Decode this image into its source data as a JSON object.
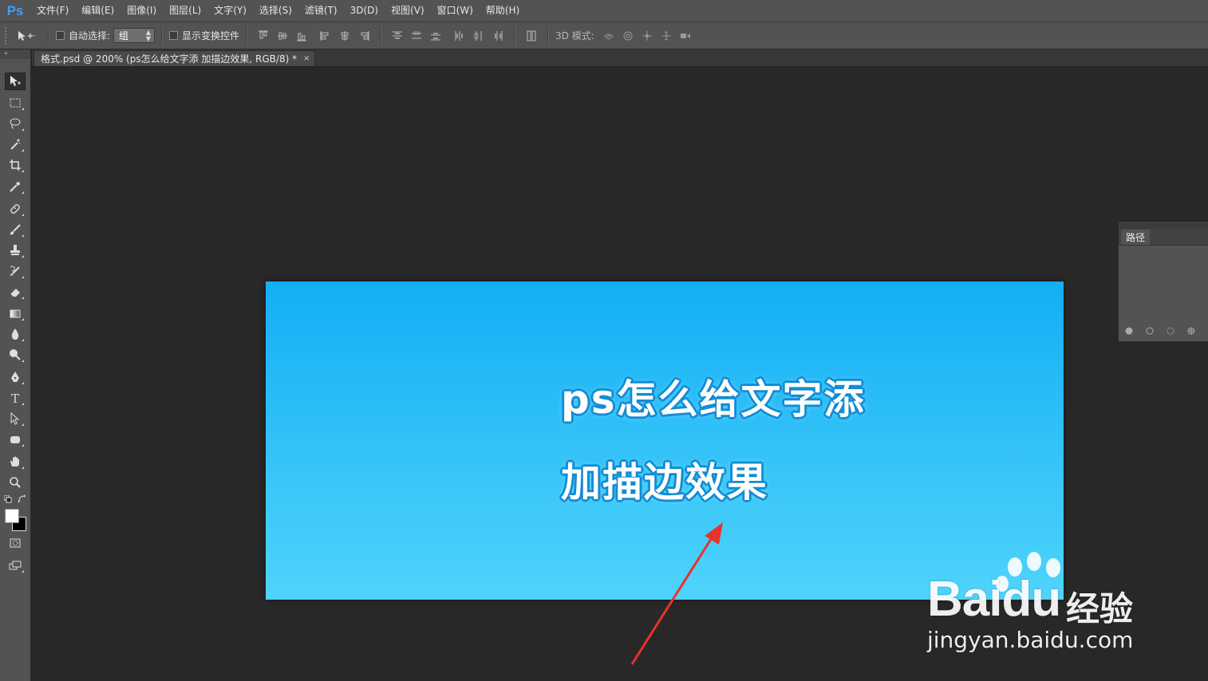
{
  "app": {
    "logo": "Ps",
    "menus": [
      "文件(F)",
      "编辑(E)",
      "图像(I)",
      "图层(L)",
      "文字(Y)",
      "选择(S)",
      "滤镜(T)",
      "3D(D)",
      "视图(V)",
      "窗口(W)",
      "帮助(H)"
    ]
  },
  "options": {
    "auto_select_label": "自动选择:",
    "auto_select_value": "组",
    "show_transform_label": "显示变换控件",
    "mode3d_label": "3D 模式:"
  },
  "document": {
    "tab_title": "格式.psd @ 200% (ps怎么给文字添 加描边效果, RGB/8) *",
    "close_glyph": "×"
  },
  "canvas": {
    "line1": "ps怎么给文字添",
    "line2": "加描边效果",
    "gradient_top": "#14aef5",
    "gradient_bottom": "#4fd4fb"
  },
  "panels": {
    "paths_tab": "路径"
  },
  "watermark": {
    "brand": "Bai",
    "brand_suffix": "du",
    "cn": "经验",
    "url": "jingyan.baidu.com"
  },
  "colors": {
    "arrow": "#e8322c",
    "ps_blue": "#3aa0ff"
  }
}
